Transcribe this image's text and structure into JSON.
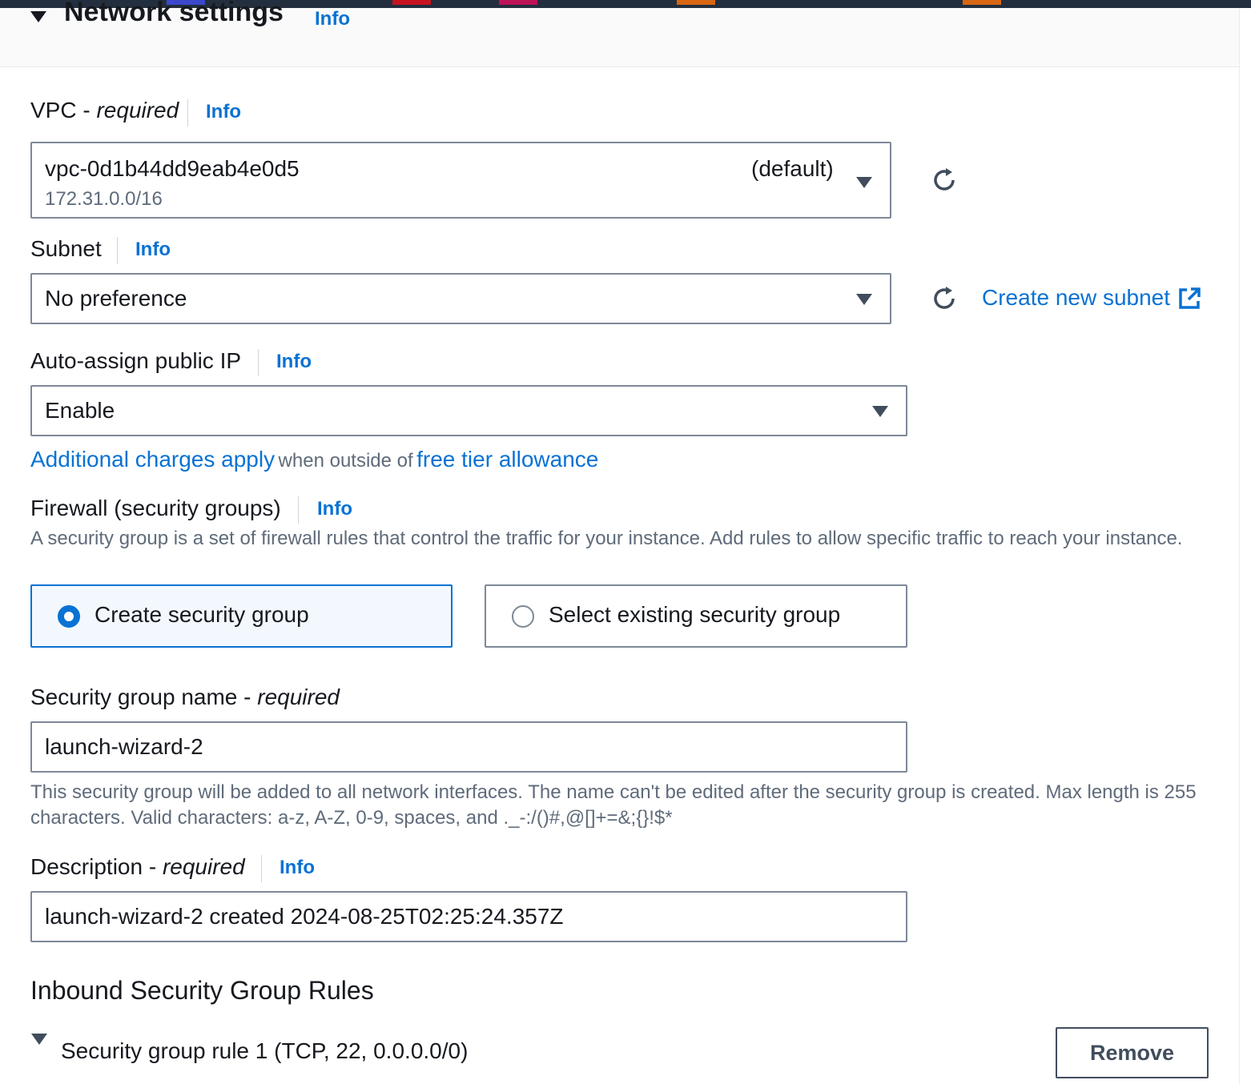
{
  "section": {
    "title": "Network settings",
    "info": "Info"
  },
  "vpc": {
    "label": "VPC",
    "required": "required",
    "info": "Info",
    "value": "vpc-0d1b44dd9eab4e0d5",
    "tag": "(default)",
    "cidr": "172.31.0.0/16"
  },
  "subnet": {
    "label": "Subnet",
    "info": "Info",
    "value": "No preference",
    "create_link": "Create new subnet"
  },
  "public_ip": {
    "label": "Auto-assign public IP",
    "info": "Info",
    "value": "Enable",
    "charges_link": "Additional charges apply",
    "charges_mid": "when outside of",
    "free_tier_link": "free tier allowance"
  },
  "firewall": {
    "label": "Firewall (security groups)",
    "info": "Info",
    "description": "A security group is a set of firewall rules that control the traffic for your instance. Add rules to allow specific traffic to reach your instance.",
    "options": [
      {
        "label": "Create security group",
        "selected": true
      },
      {
        "label": "Select existing security group",
        "selected": false
      }
    ]
  },
  "sg_name": {
    "label": "Security group name",
    "required": "required",
    "value": "launch-wizard-2",
    "help": "This security group will be added to all network interfaces. The name can't be edited after the security group is created. Max length is 255 characters. Valid characters: a-z, A-Z, 0-9, spaces, and ._-:/()#,@[]+=&;{}!$*"
  },
  "description": {
    "label": "Description",
    "required": "required",
    "info": "Info",
    "value": "launch-wizard-2 created 2024-08-25T02:25:24.357Z"
  },
  "inbound": {
    "title": "Inbound Security Group Rules",
    "rule_label": "Security group rule 1 (TCP, 22, 0.0.0.0/0)",
    "remove_label": "Remove"
  },
  "colors": {
    "link": "#0972d3",
    "text": "#16191f",
    "muted": "#5f6b7a",
    "border": "#7d8998",
    "selected_bg": "#f2f8fd"
  }
}
